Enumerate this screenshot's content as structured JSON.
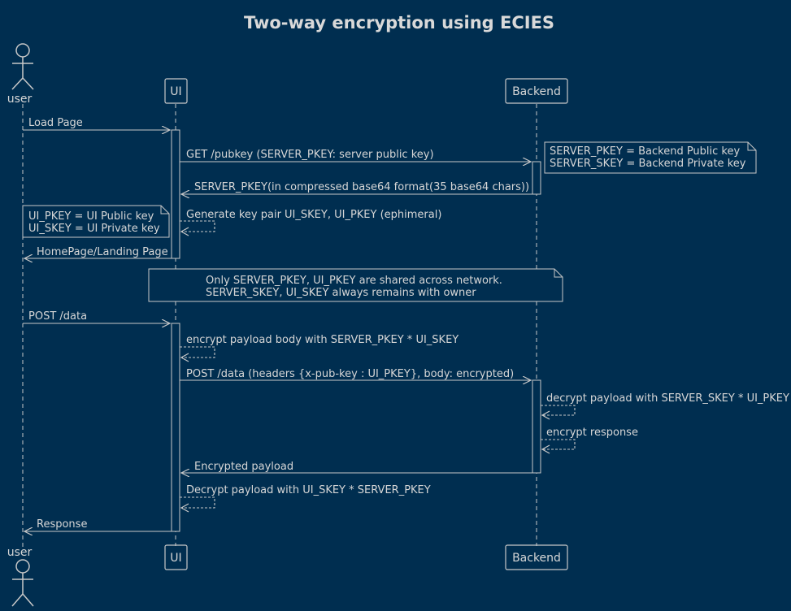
{
  "colors": {
    "background": "#002e50",
    "stroke": "#c8c8c8",
    "text": "#d6d6d6"
  },
  "title": "Two-way encryption using ECIES",
  "participants": {
    "user": "user",
    "ui": "UI",
    "backend": "Backend"
  },
  "messages": [
    {
      "label": "Load Page"
    },
    {
      "label": "GET /pubkey (SERVER_PKEY: server public key)"
    },
    {
      "label": "SERVER_PKEY(in compressed base64 format(35 base64 chars))"
    },
    {
      "label": "Generate key pair UI_SKEY, UI_PKEY (ephimeral)"
    },
    {
      "label": "HomePage/Landing Page"
    },
    {
      "label": "POST /data"
    },
    {
      "label": "encrypt payload body with SERVER_PKEY * UI_SKEY"
    },
    {
      "label": "POST /data (headers {x-pub-key : UI_PKEY}, body: encrypted)"
    },
    {
      "label": "decrypt payload with SERVER_SKEY * UI_PKEY"
    },
    {
      "label": "encrypt response"
    },
    {
      "label": "Encrypted payload"
    },
    {
      "label": "Decrypt payload with UI_SKEY * SERVER_PKEY"
    },
    {
      "label": "Response"
    }
  ],
  "notes": [
    {
      "lines": [
        "SERVER_PKEY = Backend Public key",
        "SERVER_SKEY = Backend Private key"
      ]
    },
    {
      "lines": [
        "UI_PKEY = UI Public key",
        "UI_SKEY = UI Private key"
      ]
    },
    {
      "lines": [
        "Only SERVER_PKEY, UI_PKEY are shared across network.",
        "SERVER_SKEY, UI_SKEY always remains with owner"
      ]
    }
  ]
}
